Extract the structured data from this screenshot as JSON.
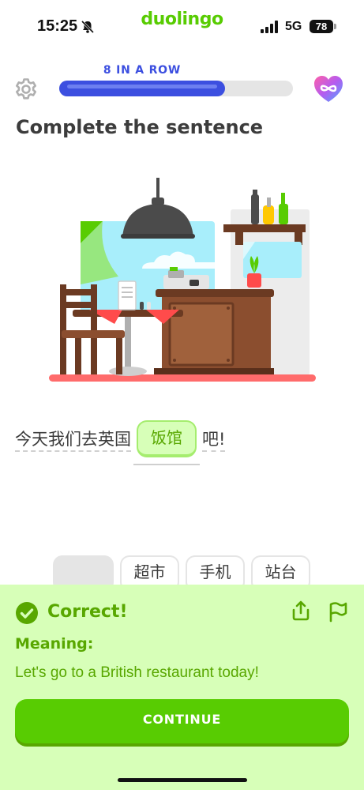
{
  "status_bar": {
    "time": "15:25",
    "brand": "duolingo",
    "network": "5G",
    "battery": "78",
    "icons": [
      "bell-off-icon",
      "signal-icon",
      "battery-icon"
    ]
  },
  "header": {
    "streak_label": "8 IN A ROW",
    "progress": 0.71,
    "icons": [
      "gear-icon",
      "infinite-hearts-icon"
    ]
  },
  "lesson": {
    "title": "Complete the sentence",
    "sentence_before": "今天我们去英国",
    "answer": "饭馆",
    "sentence_after": "吧!",
    "word_bank": [
      "超市",
      "手机",
      "站台"
    ]
  },
  "feedback": {
    "status": "Correct!",
    "meaning_label": "Meaning:",
    "meaning_text": "Let's go to a British restaurant today!",
    "continue_label": "CONTINUE",
    "icons": [
      "check-circle-icon",
      "share-icon",
      "report-flag-icon"
    ]
  },
  "colors": {
    "brand_green": "#58cc02",
    "feedback_bg": "#d7ffb8",
    "feedback_text": "#58a700",
    "progress_blue": "#3c4fe0"
  }
}
